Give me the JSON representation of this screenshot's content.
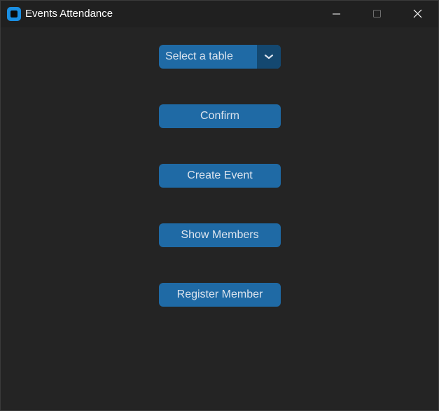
{
  "window": {
    "title": "Events Attendance",
    "icon": "app-icon",
    "controls": [
      "minimize-icon",
      "maximize-icon",
      "close-icon"
    ]
  },
  "table_select": {
    "selected": "Select a table",
    "arrow_icon": "chevron-down-icon"
  },
  "buttons": {
    "confirm": "Confirm",
    "create_event": "Create Event",
    "show_members": "Show Members",
    "register_member": "Register Member"
  },
  "colors": {
    "background": "#242424",
    "titlebar": "#202020",
    "button": "#1f6aa5",
    "button_dark": "#144870",
    "button_text": "#dce4ee",
    "app_icon": "#1a8fe3"
  }
}
